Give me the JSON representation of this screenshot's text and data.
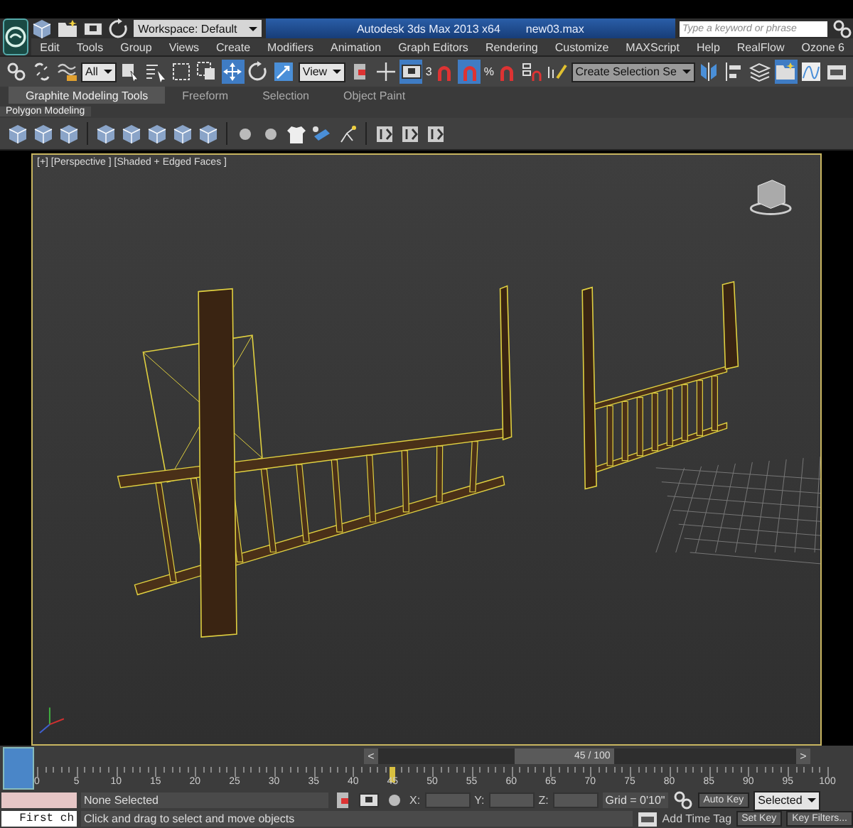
{
  "title_bar": {
    "workspace": "Workspace: Default",
    "title": "Autodesk 3ds Max  2013 x64",
    "file": "new03.max",
    "search": {
      "placeholder": "Type a keyword or phrase"
    }
  },
  "menu": [
    "Edit",
    "Tools",
    "Group",
    "Views",
    "Create",
    "Modifiers",
    "Animation",
    "Graph Editors",
    "Rendering",
    "Customize",
    "MAXScript",
    "Help",
    "RealFlow",
    "Ozone 6"
  ],
  "main_toolbar": [
    {
      "kind": "tool",
      "selected": false
    },
    {
      "kind": "tool",
      "selected": false
    },
    {
      "kind": "tool",
      "selected": false
    },
    {
      "kind": "dropdown",
      "value": "All"
    },
    {
      "kind": "tool",
      "selected": false
    },
    {
      "kind": "tool",
      "selected": false
    },
    {
      "kind": "tool",
      "selected": false
    },
    {
      "kind": "tool",
      "selected": false
    },
    {
      "kind": "tool",
      "selected": true
    },
    {
      "kind": "tool",
      "selected": false
    },
    {
      "kind": "tool",
      "selected": false
    },
    {
      "kind": "dropdown",
      "value": "View"
    },
    {
      "kind": "tool",
      "selected": false
    },
    {
      "kind": "tool",
      "selected": false
    },
    {
      "kind": "tool",
      "selected": true
    },
    {
      "kind": "snap",
      "label": "3",
      "selected": false
    },
    {
      "kind": "snap",
      "selected": true
    },
    {
      "kind": "snap",
      "label": "%",
      "selected": false
    },
    {
      "kind": "tool",
      "selected": false
    },
    {
      "kind": "tool",
      "selected": false
    },
    {
      "kind": "dropdown",
      "value": "Create Selection Se"
    },
    {
      "kind": "tool",
      "selected": false
    },
    {
      "kind": "tool",
      "selected": false
    },
    {
      "kind": "tool",
      "selected": false
    },
    {
      "kind": "tool",
      "selected": true
    },
    {
      "kind": "tool",
      "selected": false
    },
    {
      "kind": "tool",
      "selected": false
    }
  ],
  "ribbon": {
    "tabs": [
      {
        "label": "Graphite Modeling Tools",
        "selected": true
      },
      {
        "label": "Freeform",
        "selected": false
      },
      {
        "label": "Selection",
        "selected": false
      },
      {
        "label": "Object Paint",
        "selected": false
      }
    ],
    "panel": "Polygon Modeling"
  },
  "viewport": {
    "label": "[+] [Perspective ] [Shaded + Edged Faces ]",
    "active": true
  },
  "timeline": {
    "frame": "45 / 100",
    "level": 0.45,
    "prev": "<",
    "next": ">"
  },
  "ruler": [
    "0",
    "5",
    "10",
    "15",
    "20",
    "25",
    "30",
    "35",
    "40",
    "45",
    "50",
    "55",
    "60",
    "65",
    "70",
    "75",
    "80",
    "85",
    "90",
    "95",
    "100"
  ],
  "status": {
    "selection": "None Selected",
    "prompt": "Click and drag to select and move objects",
    "x_label": "X:",
    "y_label": "Y:",
    "z_label": "Z:",
    "grid": "Grid = 0'10\"",
    "add_time_tag": "Add Time Tag",
    "auto_key": "Auto Key",
    "key_mode": "Selected",
    "set_key": "Set Key",
    "key_filters": "Key Filters..."
  },
  "maxscript": {
    "value": "First ch"
  }
}
